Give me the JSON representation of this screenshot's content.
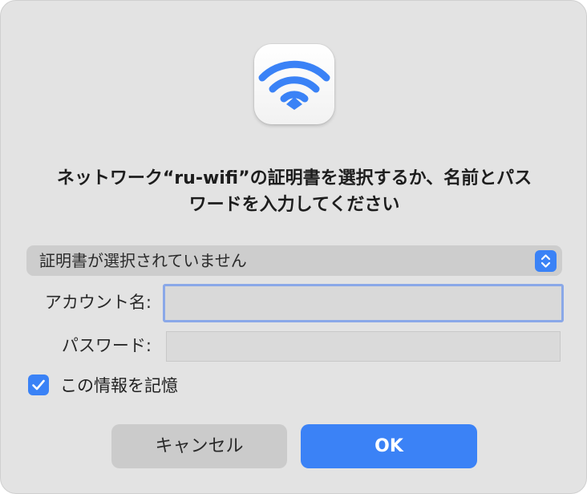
{
  "dialog": {
    "app_icon": "wifi-icon",
    "title_line1": "ネットワーク“ru-wifi”の証明書を選択するか、名前とパス",
    "title_line2": "ワードを入力してください",
    "certificate_select": {
      "value": "証明書が選択されていません",
      "icon": "up-down-chevron-icon"
    },
    "account_label": "アカウント名:",
    "account_value": "",
    "password_label": "パスワード:",
    "password_value": "",
    "remember": {
      "label": "この情報を記憶",
      "checked": true
    },
    "cancel_label": "キャンセル",
    "ok_label": "OK"
  },
  "colors": {
    "accent": "#3b82f6",
    "dialog_bg": "#e3e3e3",
    "focus_ring": "#8aa8e8"
  }
}
